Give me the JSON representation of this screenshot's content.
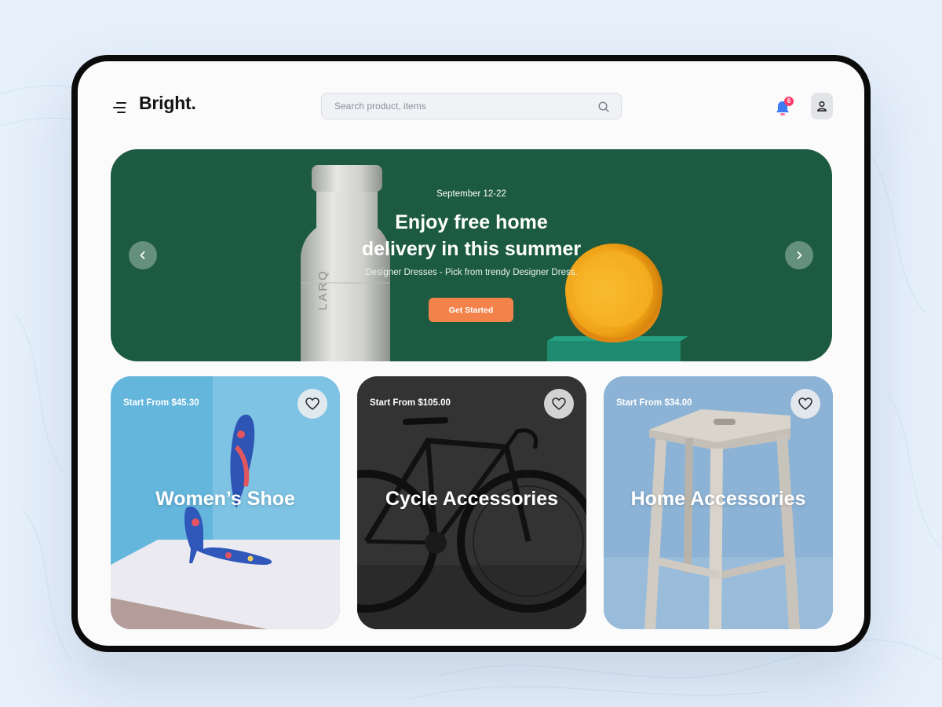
{
  "header": {
    "logo": "Bright.",
    "search_placeholder": "Search product, items",
    "notification_count": "6"
  },
  "hero": {
    "date": "September 12-22",
    "title_line1": "Enjoy free home",
    "title_line2": "delivery in this summer",
    "subtitle": "Designer Dresses - Pick from trendy Designer Dress.",
    "cta_label": "Get Started",
    "bottle_text": "LARQ"
  },
  "cards": [
    {
      "price": "Start From $45.30",
      "title": "Women’s Shoe"
    },
    {
      "price": "Start From $105.00",
      "title": "Cycle Accessories"
    },
    {
      "price": "Start From $34.00",
      "title": "Home Accessories"
    }
  ],
  "colors": {
    "hero_bg": "#1c5a41",
    "cta": "#f3834b",
    "badge": "#ff3b6b",
    "bell": "#3d7bf4"
  }
}
